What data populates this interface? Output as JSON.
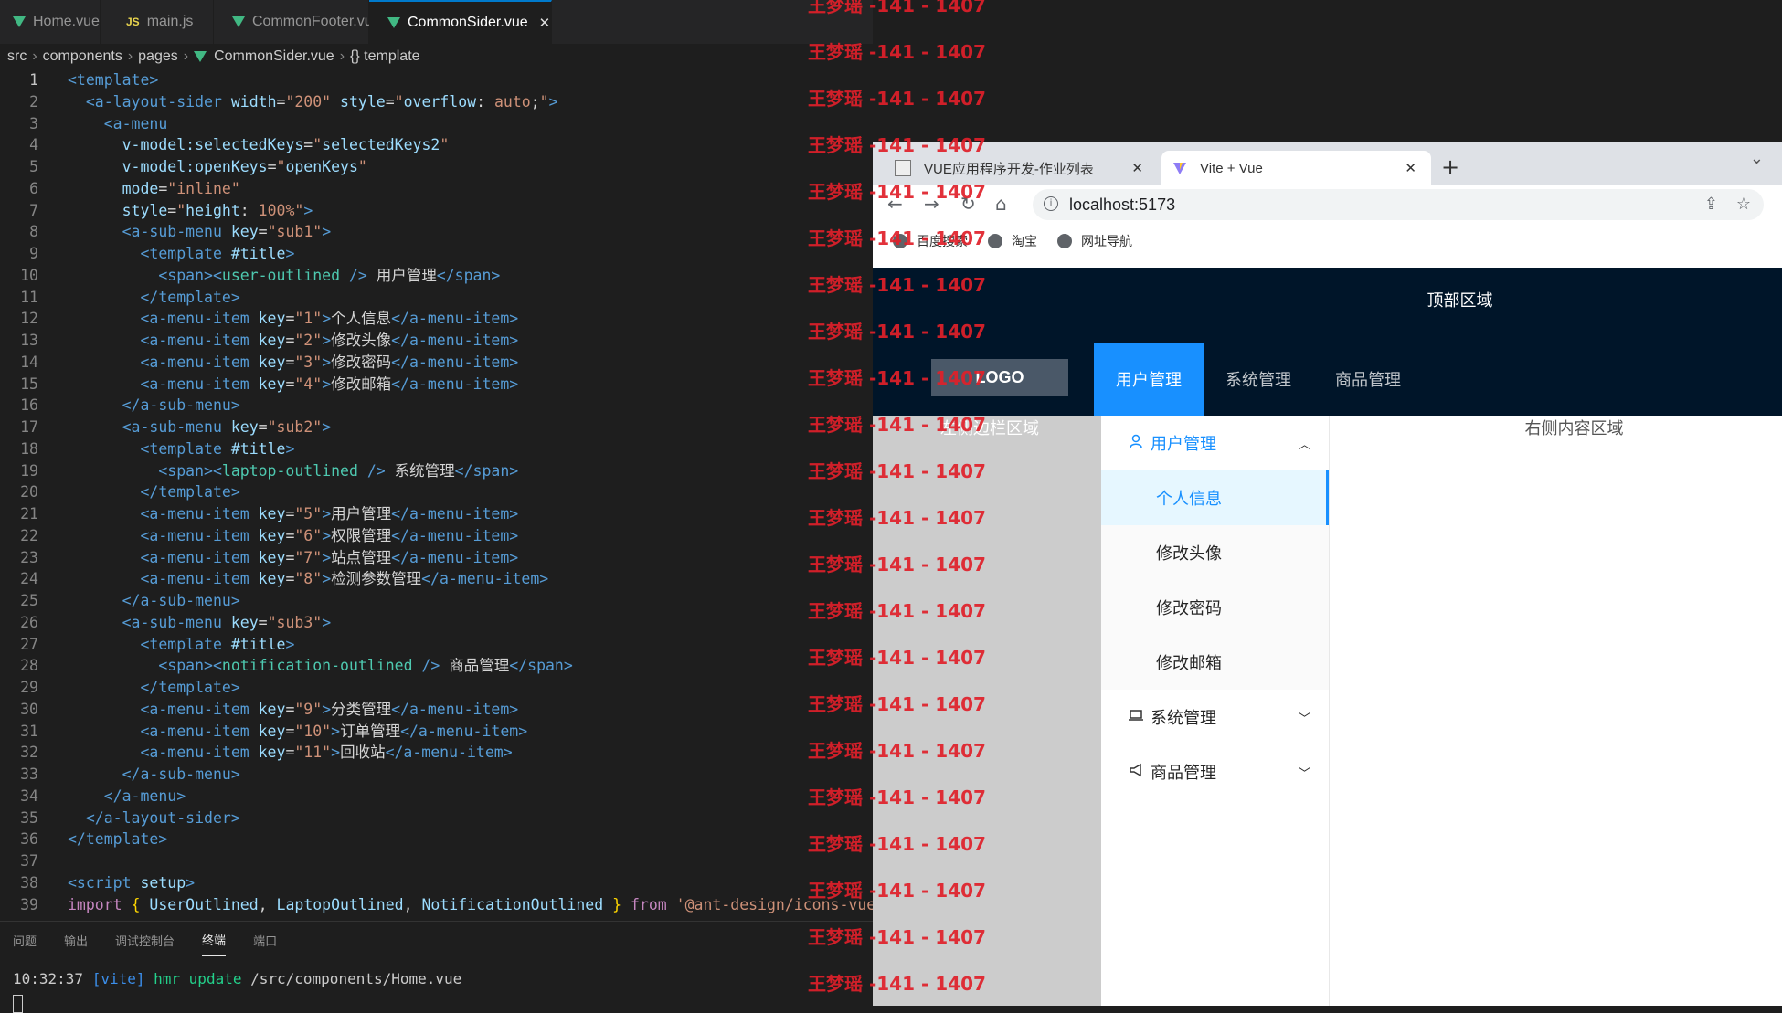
{
  "editor": {
    "tabs": [
      {
        "label": "Home.vue",
        "icon": "vue-icon"
      },
      {
        "label": "main.js",
        "icon": "js-icon"
      },
      {
        "label": "CommonFooter.vue",
        "icon": "vue-icon"
      },
      {
        "label": "CommonSider.vue",
        "icon": "vue-icon",
        "active": true
      }
    ],
    "breadcrumb": [
      "src",
      "components",
      "pages",
      "CommonSider.vue",
      "{} template"
    ],
    "panel_tabs": [
      "问题",
      "输出",
      "调试控制台",
      "终端",
      "端口"
    ],
    "terminal": {
      "time": "10:32:37",
      "tag": "[vite]",
      "event": "hmr update",
      "path": "/src/components/Home.vue"
    }
  },
  "watermark": "王梦瑶 -141 - 1407",
  "browser": {
    "tabs": [
      {
        "label": "VUE应用程序开发-作业列表",
        "icon": "book-icon"
      },
      {
        "label": "Vite + Vue",
        "icon": "vite-icon",
        "active": true
      }
    ],
    "address": "localhost:5173",
    "bookmarks": [
      "百度搜索",
      "淘宝",
      "网址导航"
    ]
  },
  "app": {
    "header_title": "顶部区域",
    "logo": "LOGO",
    "top_menu": [
      "用户管理",
      "系统管理",
      "商品管理"
    ],
    "left_area_label": "左侧边栏区域",
    "right_area_label": "右侧内容区域",
    "sider": {
      "menus": [
        {
          "title": "用户管理",
          "icon": "user-icon",
          "open": true,
          "items": [
            "个人信息",
            "修改头像",
            "修改密码",
            "修改邮箱"
          ]
        },
        {
          "title": "系统管理",
          "icon": "laptop-icon",
          "open": false
        },
        {
          "title": "商品管理",
          "icon": "notification-icon",
          "open": false
        }
      ]
    }
  },
  "colors": {
    "primary": "#1890ff",
    "header_bg": "#001529",
    "editor_bg": "#1e1e1e",
    "watermark": "#e0202a"
  }
}
